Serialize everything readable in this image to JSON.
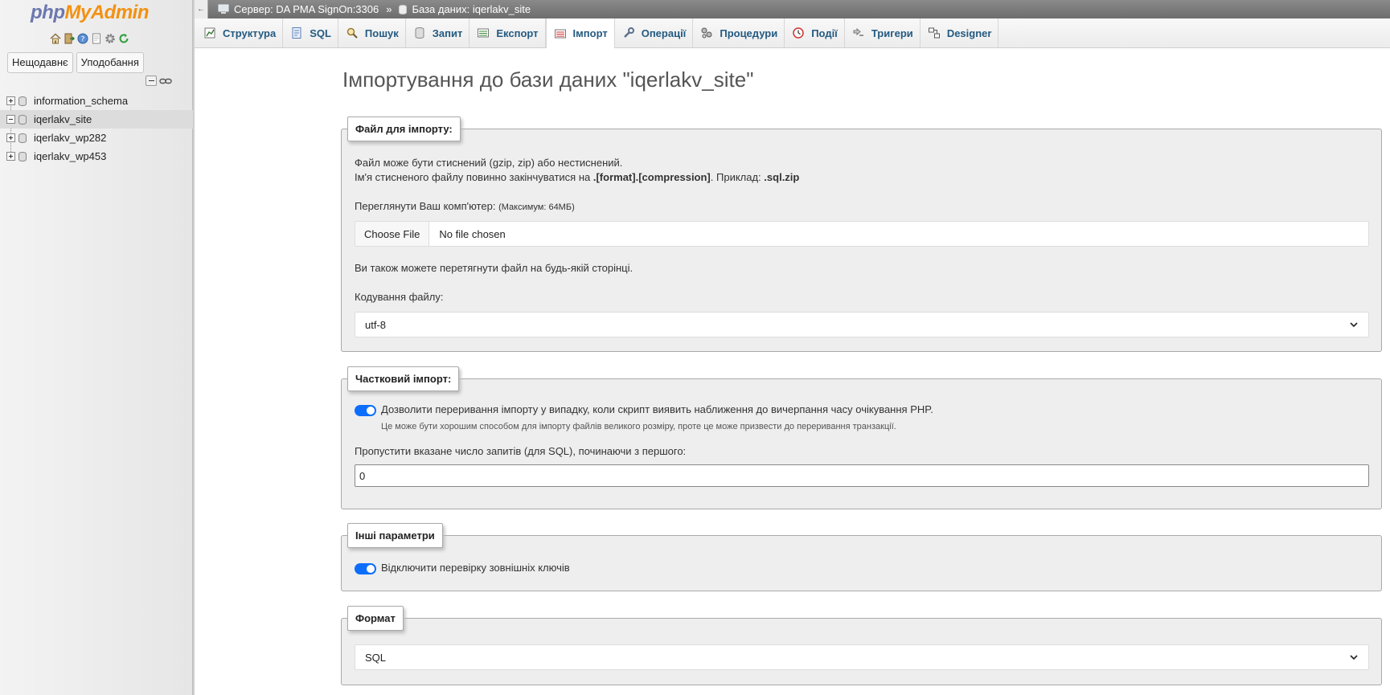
{
  "sidebar": {
    "logo": {
      "php": "php",
      "my": "My",
      "admin": "Admin"
    },
    "quick_icons": [
      "home-icon",
      "exit-icon",
      "help-icon",
      "docs-icon",
      "settings-icon",
      "reload-icon"
    ],
    "recent_label": "Нещодавнє",
    "favorites_label": "Уподобання",
    "databases": [
      {
        "name": "information_schema",
        "expanded": false
      },
      {
        "name": "iqerlakv_site",
        "expanded": true
      },
      {
        "name": "iqerlakv_wp282",
        "expanded": false
      },
      {
        "name": "iqerlakv_wp453",
        "expanded": false
      }
    ]
  },
  "breadcrumb": {
    "server": "Сервер: DA PMA SignOn:3306",
    "separator": "»",
    "database": "База даних: iqerlakv_site"
  },
  "tabs": [
    {
      "label": "Структура",
      "icon": "structure-icon"
    },
    {
      "label": "SQL",
      "icon": "sql-icon"
    },
    {
      "label": "Пошук",
      "icon": "search-icon"
    },
    {
      "label": "Запит",
      "icon": "query-icon"
    },
    {
      "label": "Експорт",
      "icon": "export-icon"
    },
    {
      "label": "Імпорт",
      "icon": "import-icon",
      "active": true
    },
    {
      "label": "Операції",
      "icon": "wrench-icon"
    },
    {
      "label": "Процедури",
      "icon": "routines-icon"
    },
    {
      "label": "Події",
      "icon": "events-icon"
    },
    {
      "label": "Тригери",
      "icon": "triggers-icon"
    },
    {
      "label": "Designer",
      "icon": "designer-icon"
    }
  ],
  "main": {
    "title": "Імпортування до бази даних \"iqerlakv_site\"",
    "file_section": {
      "legend": "Файл для імпорту:",
      "line1": "Файл може бути стиснений (gzip, zip) або нестиснений.",
      "line2_prefix": "Ім'я стисненого файлу повинно закінчуватися на ",
      "line2_format": ".[format].[compression]",
      "line2_mid": ". Приклад: ",
      "line2_example": ".sql.zip",
      "browse_label": "Переглянути Ваш комп'ютер:",
      "max_size": "(Максимум: 64МБ)",
      "choose_file": "Choose File",
      "no_file": "No file chosen",
      "drag_hint": "Ви також можете перетягнути файл на будь-якій сторінці.",
      "charset_label": "Кодування файлу:",
      "charset_value": "utf-8"
    },
    "partial_section": {
      "legend": "Частковий імпорт:",
      "allow_interrupt": "Дозволити переривання імпорту у випадку, коли скрипт виявить наближення до вичерпання часу очікування PHP.",
      "allow_interrupt_hint": "Це може бути хорошим способом для імпорту файлів великого розміру, проте це може призвести до переривання транзакції.",
      "allow_interrupt_checked": true,
      "skip_label": "Пропустити вказане число запитів (для SQL), починаючи з першого:",
      "skip_value": "0"
    },
    "other_section": {
      "legend": "Інші параметри",
      "fk_label": "Відключити перевірку зовнішніх ключів",
      "fk_checked": true
    },
    "format_section": {
      "legend": "Формат",
      "format_value": "SQL"
    }
  }
}
